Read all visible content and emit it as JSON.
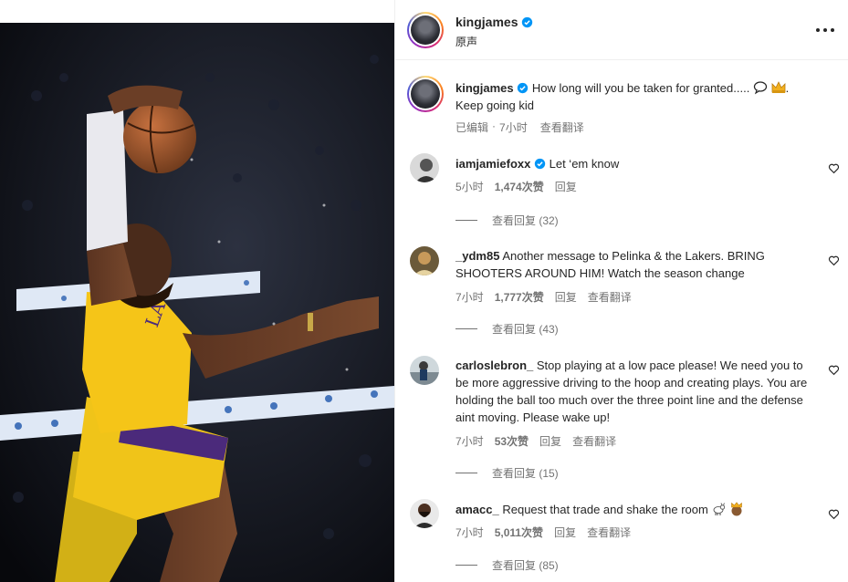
{
  "post": {
    "author": "kingjames",
    "audio": "原声",
    "caption_text": "How long will you be taken for granted.....",
    "caption_tail": ".",
    "caption_line2": "Keep going kid",
    "caption_meta": [
      "已编辑",
      "7小时"
    ],
    "see_translation": "查看翻译"
  },
  "comments": [
    {
      "user": "iamjamiefoxx",
      "verified": true,
      "text": "Let ‘em know",
      "time": "5小时",
      "likes": "1,474次赞",
      "reply": "回复",
      "translate": "",
      "view_replies": "查看回复 (32)"
    },
    {
      "user": "_ydm85",
      "verified": false,
      "text": "Another message to Pelinka & the Lakers. BRING SHOOTERS AROUND HIM! Watch the season change",
      "time": "7小时",
      "likes": "1,777次赞",
      "reply": "回复",
      "translate": "查看翻译",
      "view_replies": "查看回复 (43)"
    },
    {
      "user": "carloslebron_",
      "verified": false,
      "text": "Stop playing at a low pace please! We need you to be more aggressive driving to the hoop and creating plays. You are holding the ball too much over the three point line and the defense aint moving. Please wake up!",
      "time": "7小时",
      "likes": "53次赞",
      "reply": "回复",
      "translate": "查看翻译",
      "view_replies": "查看回复 (15)"
    },
    {
      "user": "amacc_",
      "verified": false,
      "text": "Request that trade and shake the room",
      "time": "7小时",
      "likes": "5,011次赞",
      "reply": "回复",
      "translate": "查看翻译",
      "view_replies": "查看回复 (85)"
    }
  ],
  "colors": {
    "verified": "#0095f6",
    "muted": "#737373",
    "jersey_gold": "#f5c518",
    "jersey_purple": "#4b2a7b"
  },
  "icons": [
    "verified-icon",
    "speech-bubble-icon",
    "crown-icon",
    "goat-icon",
    "heart-icon",
    "more-icon"
  ]
}
